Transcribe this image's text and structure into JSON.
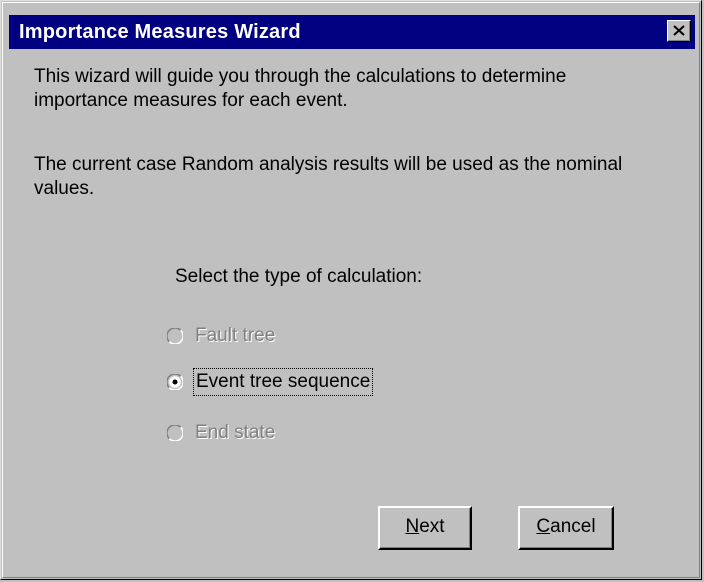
{
  "window": {
    "title": "Importance Measures Wizard"
  },
  "intro": {
    "line1": "This wizard will guide you through the calculations to determine",
    "line2": "importance measures for each event."
  },
  "note": {
    "line1": "The current case Random analysis results will be used as the nominal",
    "line2": "values."
  },
  "calculation": {
    "prompt": "Select the type of calculation:",
    "options": [
      {
        "label": "Fault tree",
        "enabled": false,
        "selected": false
      },
      {
        "label": "Event tree sequence",
        "enabled": true,
        "selected": true
      },
      {
        "label": "End state",
        "enabled": false,
        "selected": false
      }
    ]
  },
  "buttons": {
    "next_mnemonic": "N",
    "next_rest": "ext",
    "cancel_mnemonic": "C",
    "cancel_rest": "ancel"
  },
  "icons": {
    "close": "close-icon",
    "radio": "radio-button-icon"
  }
}
